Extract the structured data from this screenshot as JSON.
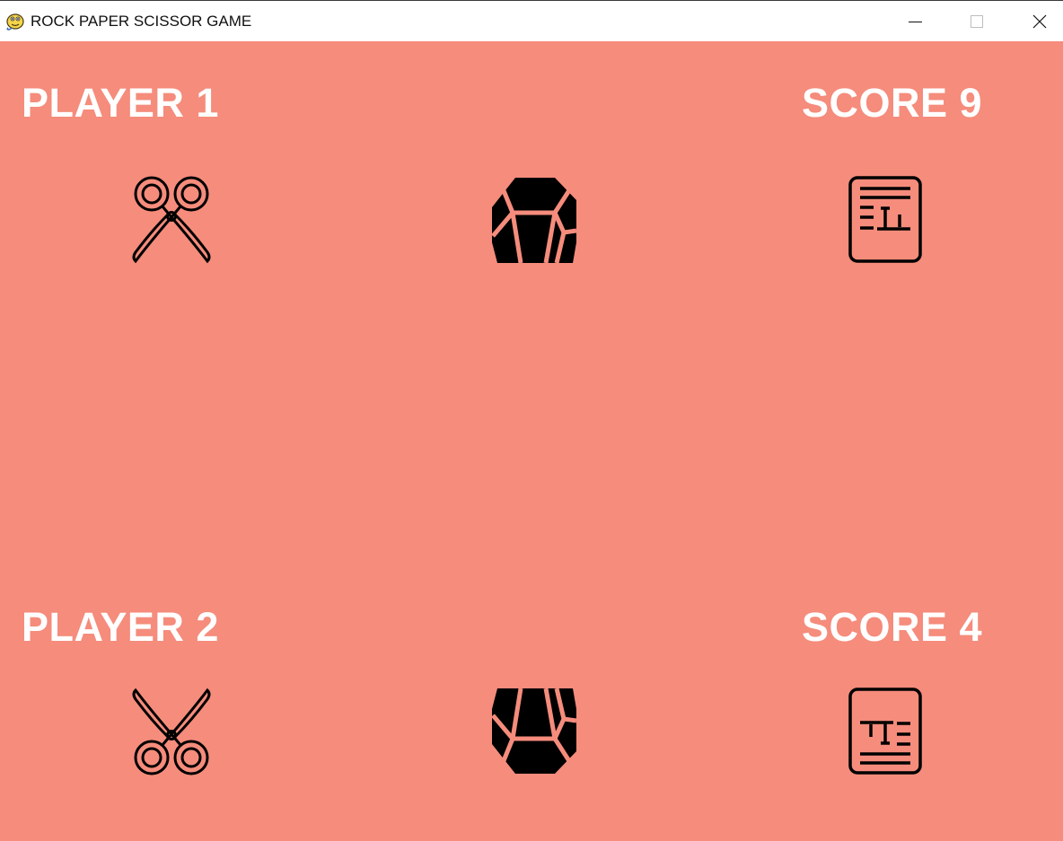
{
  "window": {
    "title": "ROCK PAPER SCISSOR GAME",
    "icon": "python-snake-icon",
    "controls": [
      "minimize-icon",
      "maximize-icon",
      "close-icon"
    ]
  },
  "colors": {
    "background": "#f58c7c",
    "text": "#ffffff",
    "icon": "#000000"
  },
  "player1": {
    "label": "PLAYER 1",
    "score_label": "SCORE 9",
    "score": 9,
    "choices": [
      "scissors-icon",
      "rock-icon",
      "paper-icon"
    ]
  },
  "player2": {
    "label": "PLAYER 2",
    "score_label": "SCORE 4",
    "score": 4,
    "choices": [
      "scissors-icon",
      "rock-icon",
      "paper-icon"
    ]
  }
}
